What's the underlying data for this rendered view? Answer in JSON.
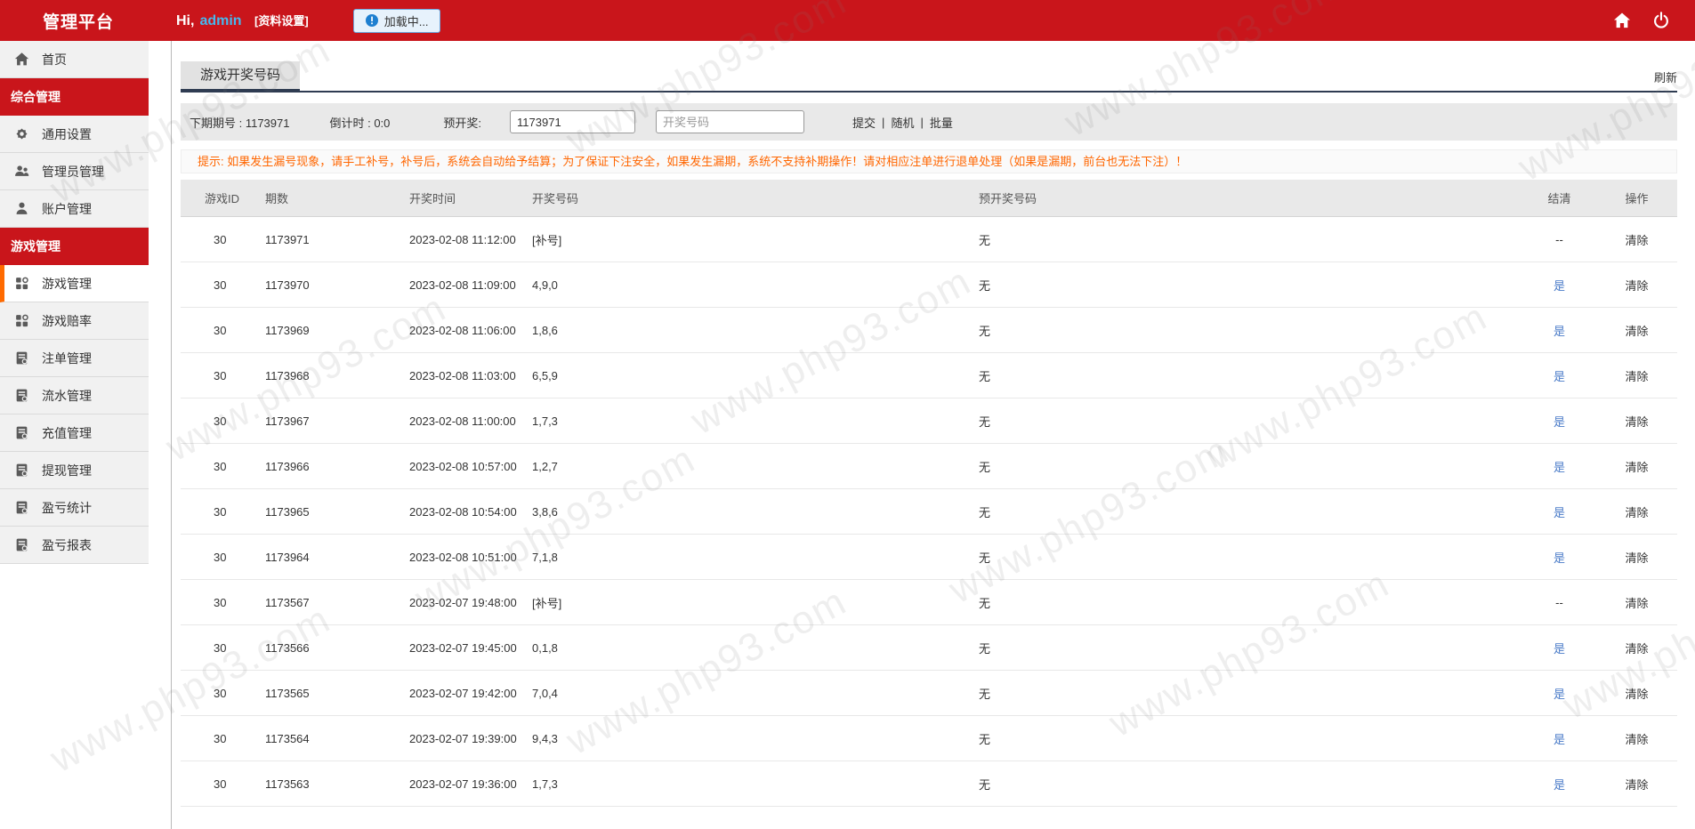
{
  "watermark": {
    "text": "www.php93.com"
  },
  "header": {
    "title": "管理平台",
    "greeting_prefix": "Hi,",
    "username": "admin",
    "profile_link": "[资料设置]",
    "loading_button": "加载中...",
    "accent_red": "#c9151b"
  },
  "sidebar": {
    "active_accent": "#ff6a00",
    "items": [
      {
        "name": "home",
        "label": "首页",
        "type": "item",
        "icon": "home-icon"
      },
      {
        "name": "general-management",
        "label": "综合管理",
        "type": "section"
      },
      {
        "name": "general-settings",
        "label": "通用设置",
        "type": "item",
        "icon": "gear-icon"
      },
      {
        "name": "admin-management",
        "label": "管理员管理",
        "type": "item",
        "icon": "users-icon"
      },
      {
        "name": "account-management",
        "label": "账户管理",
        "type": "item",
        "icon": "user-icon"
      },
      {
        "name": "game-management-section",
        "label": "游戏管理",
        "type": "section"
      },
      {
        "name": "game-management",
        "label": "游戏管理",
        "type": "item",
        "icon": "grid-icon",
        "active": true
      },
      {
        "name": "game-odds",
        "label": "游戏赔率",
        "type": "item",
        "icon": "grid-icon"
      },
      {
        "name": "bet-order-management",
        "label": "注单管理",
        "type": "item",
        "icon": "doc-icon"
      },
      {
        "name": "turnover-management",
        "label": "流水管理",
        "type": "item",
        "icon": "doc-icon"
      },
      {
        "name": "recharge-management",
        "label": "充值管理",
        "type": "item",
        "icon": "doc-icon"
      },
      {
        "name": "withdraw-management",
        "label": "提现管理",
        "type": "item",
        "icon": "doc-icon"
      },
      {
        "name": "profit-loss-stats",
        "label": "盈亏统计",
        "type": "item",
        "icon": "doc-icon"
      },
      {
        "name": "profit-loss-report",
        "label": "盈亏报表",
        "type": "item",
        "icon": "doc-icon"
      }
    ]
  },
  "main": {
    "tab": "游戏开奖号码",
    "refresh": "刷新",
    "toolbar": {
      "next_issue": "下期期号 : 1173971",
      "countdown": "倒计时 : 0:0",
      "pre_draw_label": "预开奖:",
      "pre_draw_value": "1173971",
      "draw_number_placeholder": "开奖号码",
      "actions": [
        "提交",
        "随机",
        "批量"
      ]
    },
    "notice": "提示: 如果发生漏号现象，请手工补号，补号后，系统会自动给予结算；为了保证下注安全，如果发生漏期，系统不支持补期操作！请对相应注单进行退单处理（如果是漏期，前台也无法下注）！",
    "table": {
      "columns": [
        "游戏ID",
        "期数",
        "开奖时间",
        "开奖号码",
        "预开奖号码",
        "结清",
        "操作"
      ],
      "link_blue": "#4a7bc8",
      "makeup_label": "[补号]",
      "rows": [
        [
          "30",
          "1173971",
          "2023-02-08 11:12:00",
          "[补号]",
          "无",
          "--",
          "清除"
        ],
        [
          "30",
          "1173970",
          "2023-02-08 11:09:00",
          "4,9,0",
          "无",
          "是",
          "清除"
        ],
        [
          "30",
          "1173969",
          "2023-02-08 11:06:00",
          "1,8,6",
          "无",
          "是",
          "清除"
        ],
        [
          "30",
          "1173968",
          "2023-02-08 11:03:00",
          "6,5,9",
          "无",
          "是",
          "清除"
        ],
        [
          "30",
          "1173967",
          "2023-02-08 11:00:00",
          "1,7,3",
          "无",
          "是",
          "清除"
        ],
        [
          "30",
          "1173966",
          "2023-02-08 10:57:00",
          "1,2,7",
          "无",
          "是",
          "清除"
        ],
        [
          "30",
          "1173965",
          "2023-02-08 10:54:00",
          "3,8,6",
          "无",
          "是",
          "清除"
        ],
        [
          "30",
          "1173964",
          "2023-02-08 10:51:00",
          "7,1,8",
          "无",
          "是",
          "清除"
        ],
        [
          "30",
          "1173567",
          "2023-02-07 19:48:00",
          "[补号]",
          "无",
          "--",
          "清除"
        ],
        [
          "30",
          "1173566",
          "2023-02-07 19:45:00",
          "0,1,8",
          "无",
          "是",
          "清除"
        ],
        [
          "30",
          "1173565",
          "2023-02-07 19:42:00",
          "7,0,4",
          "无",
          "是",
          "清除"
        ],
        [
          "30",
          "1173564",
          "2023-02-07 19:39:00",
          "9,4,3",
          "无",
          "是",
          "清除"
        ],
        [
          "30",
          "1173563",
          "2023-02-07 19:36:00",
          "1,7,3",
          "无",
          "是",
          "清除"
        ]
      ]
    }
  }
}
